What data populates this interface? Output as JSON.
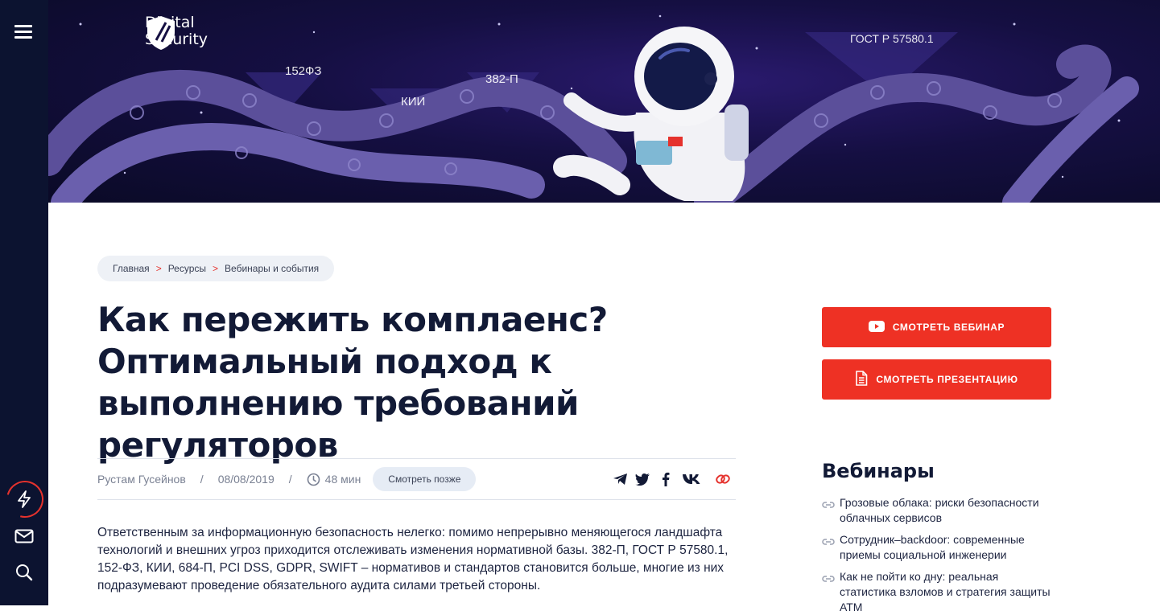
{
  "header": {
    "logo_line1": "Digital",
    "logo_line2": "Security",
    "banner_tags": [
      "152ФЗ",
      "КИИ",
      "382-П",
      "ГОСТ Р 57580.1"
    ]
  },
  "breadcrumb": {
    "items": [
      "Главная",
      "Ресурсы",
      "Вебинары и события"
    ],
    "separator": ">"
  },
  "article": {
    "title": "Как пережить комплаенс? Оптимальный подход к выполнению требований регуляторов",
    "author": "Рустам Гусейнов",
    "date": "08/08/2019",
    "read_time": "48 мин",
    "watch_later_label": "Смотреть позже",
    "lead": "Ответственным за информационную безопасность нелегко: помимо непрерывно меняющегося ландшафта технологий и внешних угроз приходится отслеживать изменения нормативной базы. 382-П, ГОСТ Р 57580.1, 152-ФЗ, КИИ, 684-П, PCI DSS, GDPR, SWIFT – нормативов и стандартов становится больше, многие из них подразумевают проведение обязательного аудита силами третьей стороны."
  },
  "actions": {
    "watch_webinar": "СМОТРЕТЬ ВЕБИНАР",
    "watch_presentation": "СМОТРЕТЬ ПРЕЗЕНТАЦИЮ"
  },
  "webinars": {
    "title": "Вебинары",
    "items": [
      "Грозовые облака: риски безопасности облачных сервисов",
      "Сотрудник–backdoor: современные приемы социальной инженерии",
      "Как не пойти ко дну: реальная статистика взломов и стратегия защиты АТМ"
    ]
  },
  "colors": {
    "accent": "#ee3124",
    "sidebar": "#0c1330",
    "heading": "#121a36"
  }
}
